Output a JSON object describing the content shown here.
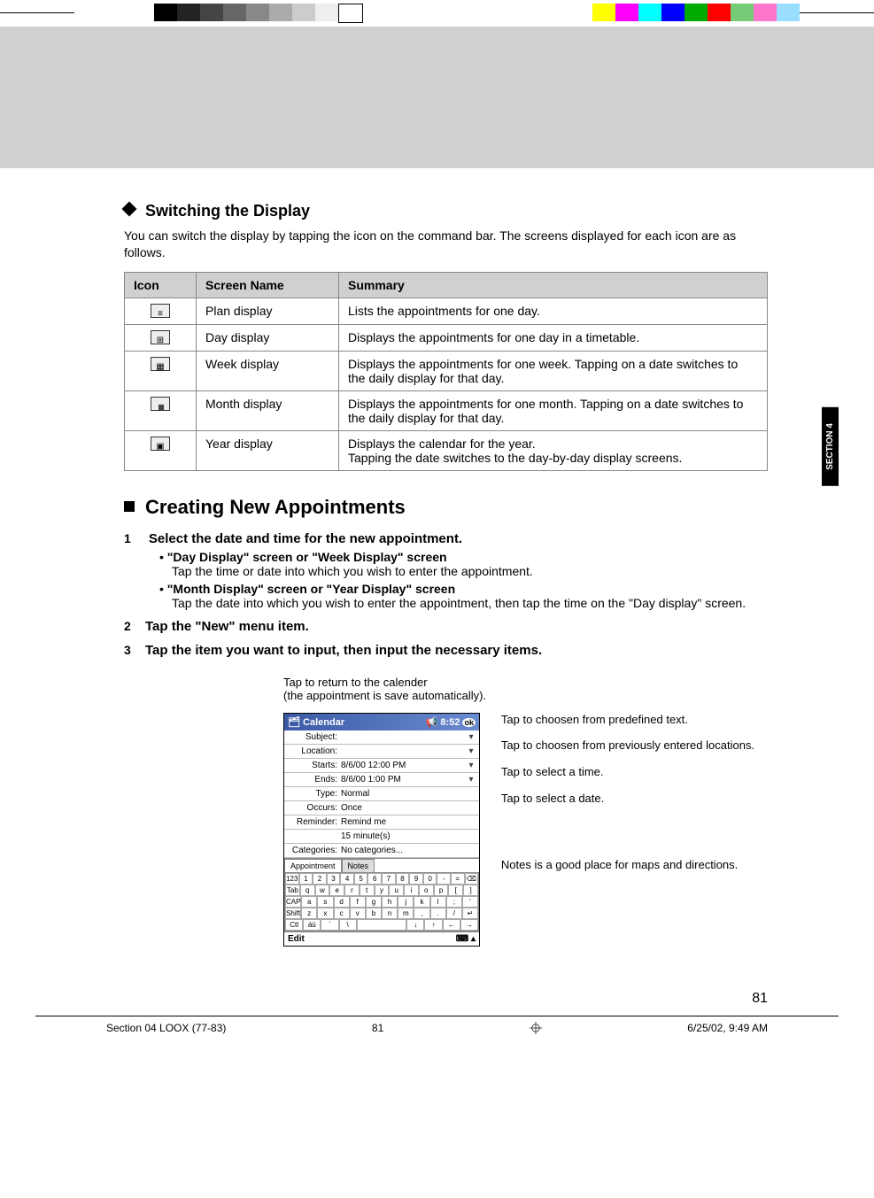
{
  "section_tab": "SECTION 4",
  "heading1": "Switching the Display",
  "intro": "You can switch the display by tapping the icon on the command bar. The screens displayed for each icon are as follows.",
  "table": {
    "headers": [
      "Icon",
      "Screen Name",
      "Summary"
    ],
    "rows": [
      {
        "icon": "plan",
        "name": "Plan display",
        "summary": "Lists the appointments for one day."
      },
      {
        "icon": "day",
        "name": "Day display",
        "summary": "Displays the appointments for one day in a timetable."
      },
      {
        "icon": "week",
        "name": "Week display",
        "summary": "Displays the appointments for one week. Tapping on a date switches to the daily display for that day."
      },
      {
        "icon": "month",
        "name": "Month display",
        "summary": "Displays the appointments for one month. Tapping on a date switches to the daily display for that day."
      },
      {
        "icon": "year",
        "name": "Year display",
        "summary": "Displays the calendar for the year.\nTapping the date switches to the day-by-day display screens."
      }
    ]
  },
  "heading2": "Creating New Appointments",
  "steps": [
    {
      "title": "Select the date and time for the new appointment.",
      "bullets": [
        {
          "title": "\"Day Display\" screen or \"Week Display\" screen",
          "desc": "Tap the time or date into which you wish to enter the appointment."
        },
        {
          "title": "\"Month Display\" screen or \"Year Display\" screen",
          "desc": "Tap the date into which you wish to enter the appointment, then tap the time on the \"Day display\" screen."
        }
      ]
    },
    {
      "title": "Tap the \"New\" menu item."
    },
    {
      "title": "Tap the item you want to input, then input the necessary items."
    }
  ],
  "figure": {
    "caption_top": "Tap to return to the calender\n(the appointment is save automatically).",
    "screenshot": {
      "title": "Calendar",
      "time": "8:52",
      "ok": "ok",
      "fields": {
        "Subject": "",
        "Location": "",
        "Starts": "8/6/00    12:00 PM",
        "Ends": "8/6/00     1:00 PM",
        "Type": "Normal",
        "Occurs": "Once",
        "Reminder": "Remind me",
        "Reminder2": "15   minute(s)",
        "Categories": "No categories..."
      },
      "tabs": [
        "Appointment",
        "Notes"
      ],
      "bottom": "Edit",
      "kbd": [
        [
          "123",
          "1",
          "2",
          "3",
          "4",
          "5",
          "6",
          "7",
          "8",
          "9",
          "0",
          "-",
          "=",
          "⌫"
        ],
        [
          "Tab",
          "q",
          "w",
          "e",
          "r",
          "t",
          "y",
          "u",
          "i",
          "o",
          "p",
          "[",
          "]"
        ],
        [
          "CAP",
          "a",
          "s",
          "d",
          "f",
          "g",
          "h",
          "j",
          "k",
          "l",
          ";",
          "'"
        ],
        [
          "Shift",
          "z",
          "x",
          "c",
          "v",
          "b",
          "n",
          "m",
          ",",
          ".",
          "/",
          "↵"
        ],
        [
          "Ctl",
          "áü",
          "`",
          "\\",
          "",
          "",
          "",
          "",
          "↓",
          "↑",
          "←",
          "→"
        ]
      ]
    },
    "callouts": [
      "Tap to choosen from predefined text.",
      "Tap to choosen from previously entered locations.",
      "Tap to select a time.",
      "Tap to select a date.",
      "Notes is a good place for maps and directions."
    ]
  },
  "page_number": "81",
  "footer": {
    "left": "Section 04 LOOX (77-83)",
    "center": "81",
    "right": "6/25/02, 9:49 AM"
  }
}
